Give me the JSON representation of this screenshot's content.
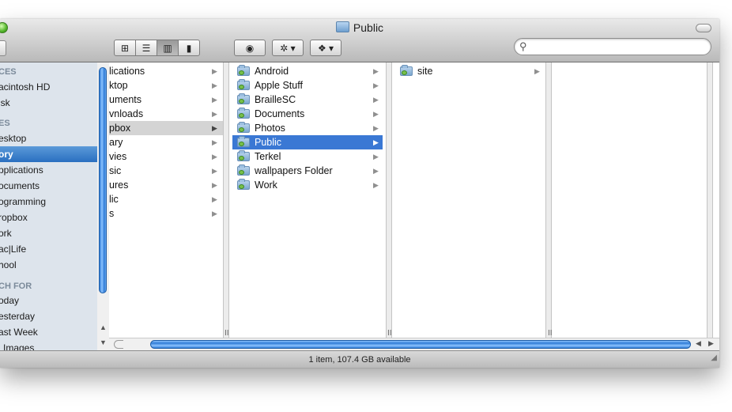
{
  "window": {
    "title": "Public"
  },
  "toolbar": {
    "view_buttons": [
      "icon-view-icon",
      "list-view-icon",
      "column-view-icon",
      "coverflow-view-icon"
    ],
    "active_view": 2,
    "quick_look_glyph": "◉",
    "action_glyph": "✲ ▾",
    "dropbox_glyph": "❖ ▾",
    "search": {
      "value": "",
      "placeholder": ""
    }
  },
  "sidebar": {
    "headers": [
      "CES",
      "ES",
      "CH FOR"
    ],
    "items": [
      "acintosh HD",
      "isk",
      "esktop",
      "ory",
      "pplications",
      "ocuments",
      "ogramming",
      "ropbox",
      "ork",
      "ac|Life",
      "hool",
      "oday",
      "esterday",
      "ast Week",
      "l Images"
    ],
    "selected_index": 3
  },
  "columns": [
    {
      "items": [
        "lications",
        "ktop",
        "uments",
        "vnloads",
        "pbox",
        "ary",
        "vies",
        "sic",
        "ures",
        "lic",
        "s"
      ],
      "selected_index": 4,
      "selection": "gray"
    },
    {
      "items": [
        "Android",
        "Apple Stuff",
        "BrailleSC",
        "Documents",
        "Photos",
        "Public",
        "Terkel",
        "wallpapers Folder",
        "Work"
      ],
      "selected_index": 5,
      "selection": "blue"
    },
    {
      "items": [
        "site"
      ],
      "selected_index": -1,
      "selection": "none"
    }
  ],
  "status": {
    "text": "1 item, 107.4 GB available"
  },
  "colors": {
    "selection_blue": "#3a78d4",
    "sidebar_bg": "#dde4ec",
    "scroll_thumb": "#2f7bd6"
  }
}
